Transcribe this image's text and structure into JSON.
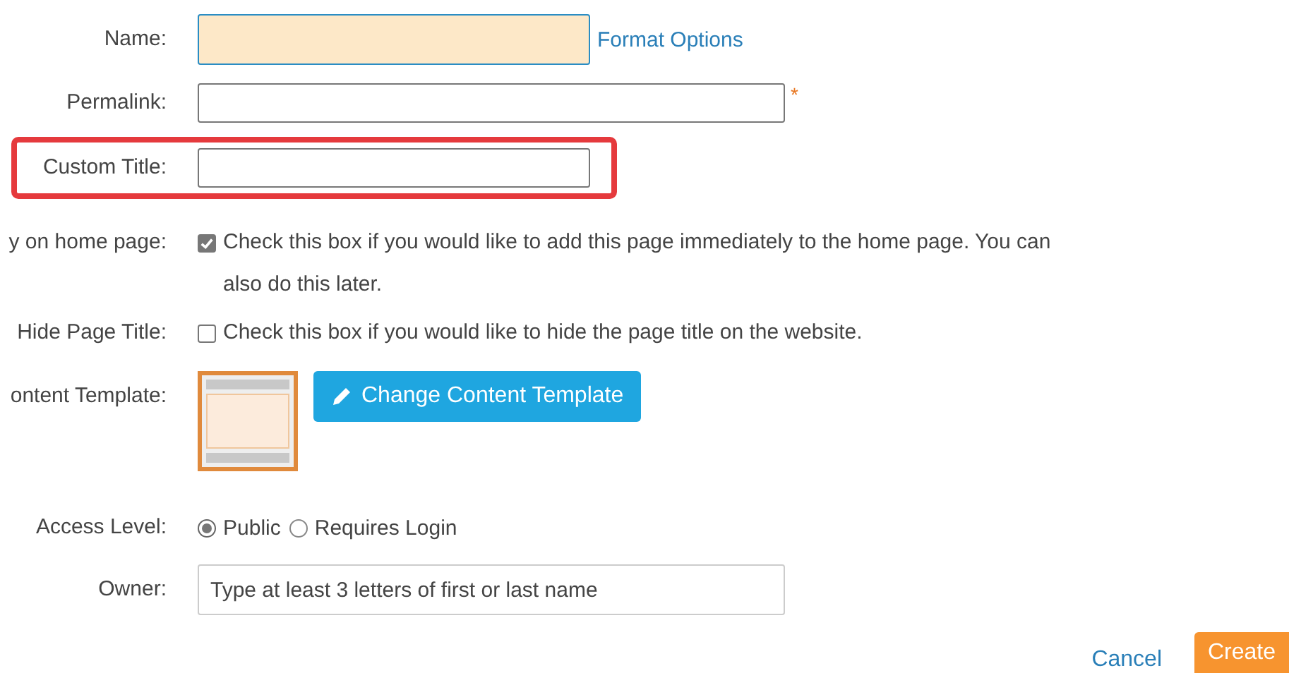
{
  "form": {
    "rows": [
      {
        "kind": "text",
        "label": "Name:",
        "active": true,
        "link": "Format Options",
        "wide": false
      },
      {
        "kind": "text",
        "label": "Permalink:",
        "required_mark": "*",
        "wide": true
      },
      {
        "kind": "text",
        "label": "Custom Title:",
        "highlighted": true,
        "wide": false
      },
      {
        "kind": "checkbox",
        "label": "y on home page:",
        "checked": true,
        "text": "Check this box if you would like to add this page immediately to the home page. You can also do this later."
      },
      {
        "kind": "checkbox",
        "label": "Hide Page Title:",
        "checked": false,
        "text": "Check this box if you would like to hide the page title on the website."
      },
      {
        "kind": "template",
        "label": "ontent Template:",
        "button": "Change Content Template"
      },
      {
        "kind": "radio",
        "label": "Access Level:",
        "options": [
          {
            "label": "Public",
            "selected": true
          },
          {
            "label": "Requires Login",
            "selected": false
          }
        ]
      },
      {
        "kind": "text",
        "label": "Owner:",
        "placeholder": "Type at least 3 letters of first or last name",
        "wide": true
      }
    ]
  },
  "actions": {
    "cancel": "Cancel",
    "create": "Create"
  }
}
